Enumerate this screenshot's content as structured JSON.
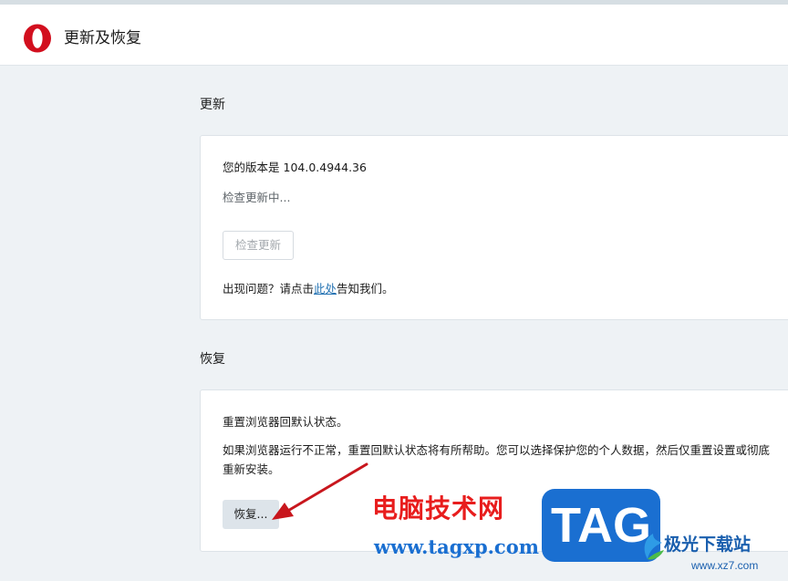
{
  "header": {
    "title": "更新及恢复"
  },
  "update": {
    "section_title": "更新",
    "version_label": "您的版本是",
    "version_value": "104.0.4944.36",
    "status": "检查更新中...",
    "check_button": "检查更新",
    "problem_prefix": "出现问题？请点击",
    "problem_link": "此处",
    "problem_suffix": "告知我们。"
  },
  "recovery": {
    "section_title": "恢复",
    "heading": "重置浏览器回默认状态。",
    "description_line1": "如果浏览器运行不正常，重置回默认状态将有所帮助。您可以选择保护您的个人数据，然后仅重置设置或彻底",
    "description_line2": "重新安装。",
    "reset_button": "恢复..."
  },
  "watermark": {
    "cn_text": "电脑技术网",
    "url": "www.tagxp.com",
    "tag": "TAG",
    "site_name": "极光下载站",
    "site_url": "www.xz7.com"
  },
  "colors": {
    "page_bg": "#eef2f5",
    "link": "#2573b3",
    "brand_red": "#d20f1e",
    "annotation_arrow": "#c8161d"
  }
}
